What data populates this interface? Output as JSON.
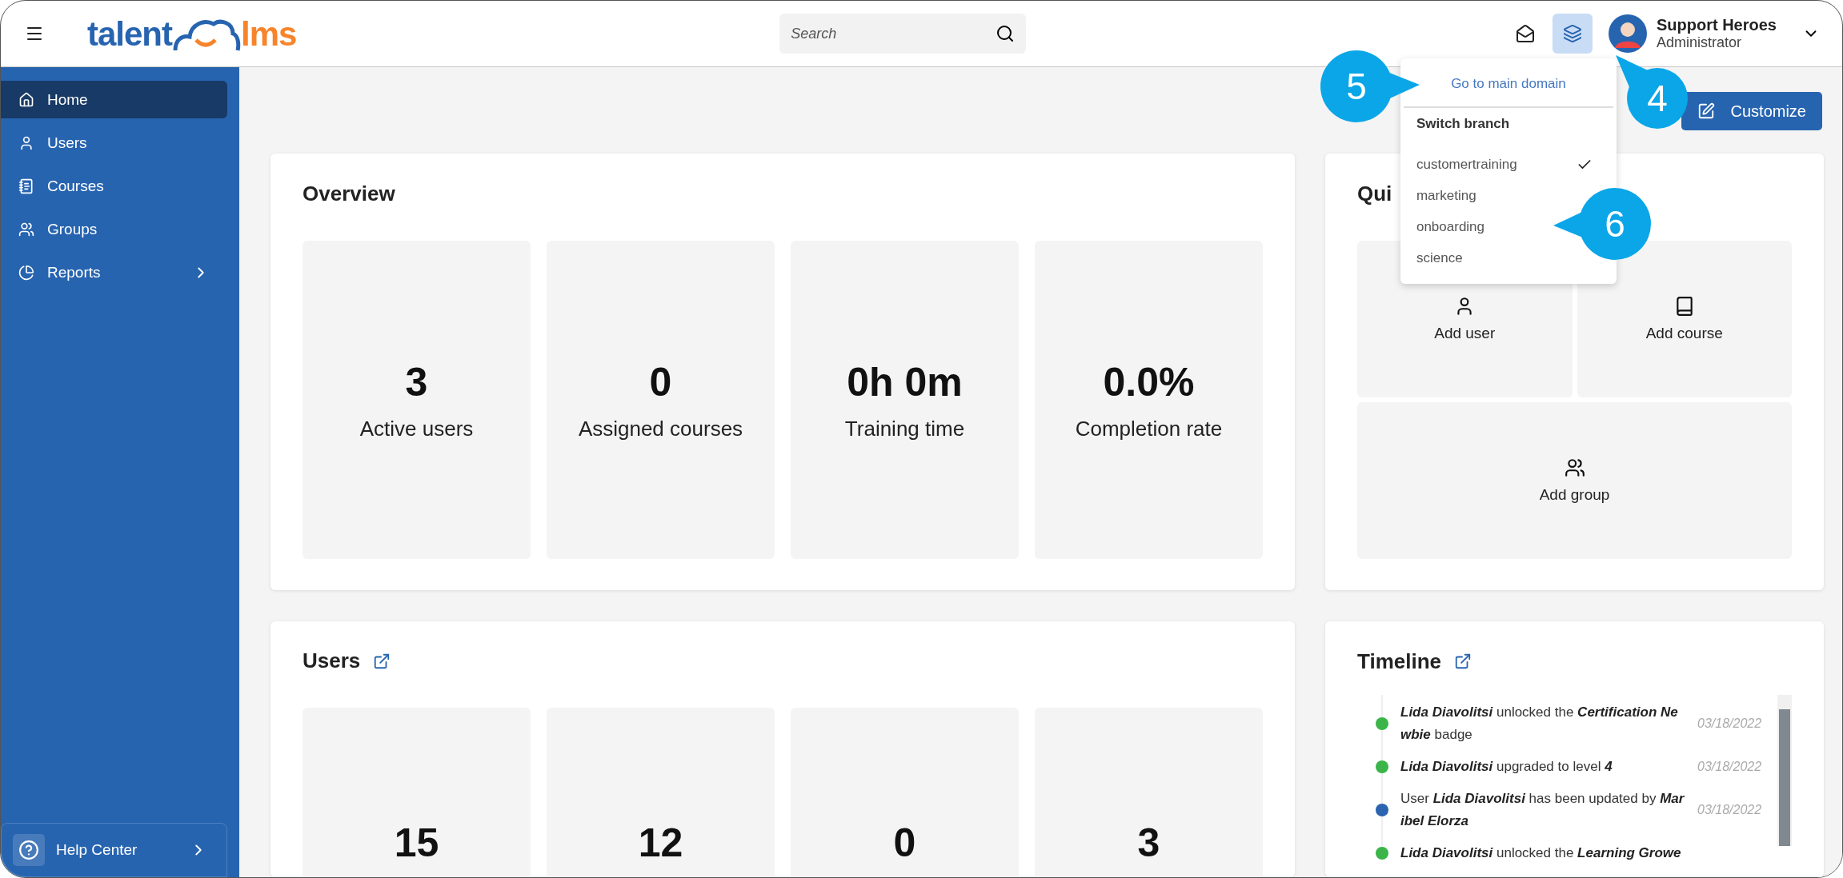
{
  "header": {
    "logo": {
      "left": "talent",
      "right": "lms"
    },
    "search": {
      "placeholder": "Search"
    },
    "user": {
      "name": "Support Heroes",
      "role": "Administrator"
    }
  },
  "branch_menu": {
    "open": true,
    "main_link": "Go to main domain",
    "heading": "Switch branch",
    "branches": [
      {
        "name": "customertraining",
        "selected": true
      },
      {
        "name": "marketing",
        "selected": false
      },
      {
        "name": "onboarding",
        "selected": false
      },
      {
        "name": "science",
        "selected": false
      }
    ]
  },
  "sidebar": {
    "items": [
      {
        "label": "Home",
        "kind": "home",
        "selected": true,
        "submenu": false
      },
      {
        "label": "Users",
        "kind": "users",
        "selected": false,
        "submenu": false
      },
      {
        "label": "Courses",
        "kind": "courses",
        "selected": false,
        "submenu": false
      },
      {
        "label": "Groups",
        "kind": "groups",
        "selected": false,
        "submenu": false
      },
      {
        "label": "Reports",
        "kind": "reports",
        "selected": false,
        "submenu": true
      }
    ],
    "help": "Help Center"
  },
  "customize_button": "Customize",
  "overview": {
    "title": "Overview",
    "stats": [
      {
        "value": "3",
        "label": "Active users"
      },
      {
        "value": "0",
        "label": "Assigned courses"
      },
      {
        "value": "0h 0m",
        "label": "Training time"
      },
      {
        "value": "0.0%",
        "label": "Completion rate"
      }
    ]
  },
  "quick_actions": {
    "title": "Qui",
    "actions": [
      {
        "label": "Add user",
        "kind": "user"
      },
      {
        "label": "Add course",
        "kind": "course"
      },
      {
        "label": "Add group",
        "kind": "group"
      }
    ]
  },
  "users": {
    "title": "Users",
    "stats": [
      {
        "value": "15"
      },
      {
        "value": "12"
      },
      {
        "value": "0"
      },
      {
        "value": "3"
      }
    ]
  },
  "timeline": {
    "title": "Timeline",
    "events": [
      {
        "text": "**Lida Diavolitsi** unlocked the **Certification Newbie** badge",
        "date": "03/18/2022",
        "color": "#3bb54a"
      },
      {
        "text": "**Lida Diavolitsi** upgraded to level **4**",
        "date": "03/18/2022",
        "color": "#3bb54a"
      },
      {
        "text": "User **Lida Diavolitsi** has been updated by **Maribel Elorza**",
        "date": "03/18/2022",
        "color": "#2a64b0"
      },
      {
        "text": "**Lida Diavolitsi** unlocked the **Learning Growe**",
        "color": "#3bb54a"
      }
    ]
  },
  "callouts": [
    {
      "label": "4"
    },
    {
      "label": "5"
    },
    {
      "label": "6"
    }
  ]
}
